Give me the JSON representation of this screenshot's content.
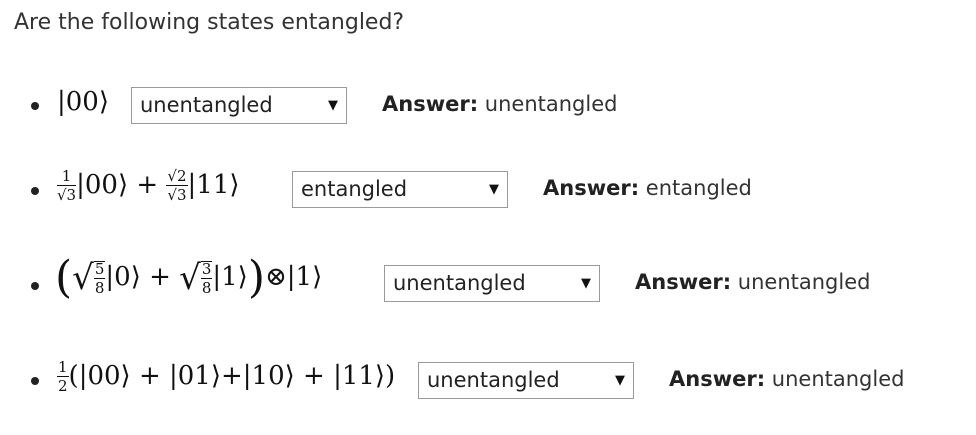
{
  "question": "Are the following states entangled?",
  "answer_label": "Answer:",
  "rows": [
    {
      "selected": "unentangled",
      "answer": "unentangled"
    },
    {
      "selected": "entangled",
      "answer": "entangled"
    },
    {
      "selected": "unentangled",
      "answer": "unentangled"
    },
    {
      "selected": "unentangled",
      "answer": "unentangled"
    }
  ],
  "math": {
    "s1": "|00⟩",
    "s2_frac1_num": "1",
    "s2_frac1_den": "√3",
    "s2_ket1": "|00⟩ +",
    "s2_frac2_num": "√2",
    "s2_frac2_den": "√3",
    "s2_ket2": "|11⟩",
    "s3_f1_num": "5",
    "s3_f1_den": "8",
    "s3_ket1": "|0⟩ +",
    "s3_f2_num": "3",
    "s3_f2_den": "8",
    "s3_ket2": "|1⟩",
    "s3_tail": "⊗|1⟩",
    "s4_frac_num": "1",
    "s4_frac_den": "2",
    "s4_body": "(|00⟩ + |01⟩+|10⟩ + |11⟩)"
  },
  "icons": {
    "caret": "▼"
  }
}
